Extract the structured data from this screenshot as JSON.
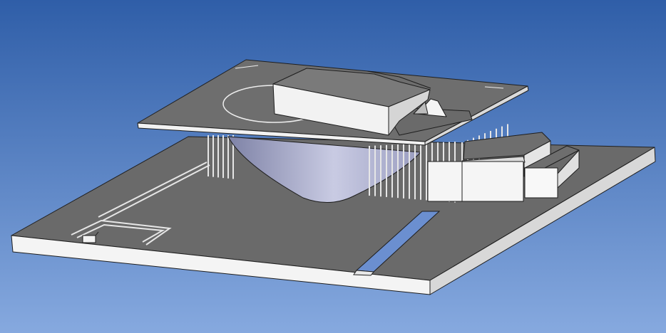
{
  "viewport": {
    "background_top": "#2f5ea8",
    "background_bottom": "#86a9df"
  },
  "model": {
    "roof_color": "#6e6e6e",
    "roof_edge_color": "#f2f2f2",
    "base_top_color": "#6a6a6a",
    "base_side_color": "#f4f4f4",
    "column_color": "#e6e6e6",
    "cone_color_light": "#c9cbe3",
    "cone_color_dark": "#7e82a6",
    "block_color": "#f5f5f5",
    "water_color": "#6b8fd0",
    "line_color": "#1e1e1e"
  }
}
